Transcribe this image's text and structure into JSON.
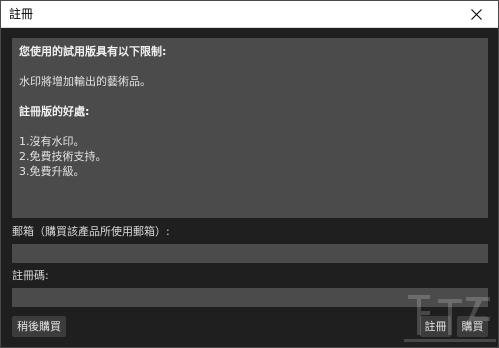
{
  "window": {
    "title": "註冊"
  },
  "icons": {
    "close": "close-icon"
  },
  "info": {
    "heading": "您使用的試用版具有以下限制:",
    "restriction": "水印將增加輸出的藝術品。",
    "benefits_heading": "註冊版的好處:",
    "benefits": [
      "1.沒有水印。",
      "2.免費技術支持。",
      "3.免費升級。"
    ]
  },
  "form": {
    "email_label": "郵箱（購買該產品所使用郵箱）:",
    "email_value": "",
    "code_label": "註冊碼:",
    "code_value": ""
  },
  "buttons": {
    "later": "稍後購買",
    "register": "註冊",
    "buy": "購買"
  },
  "colors": {
    "window_background": "#1f1f1f",
    "panel_background": "#4b4b4b",
    "titlebar_background": "#ffffff",
    "button_background": "#3c3c3c",
    "text": "#e2e2e2"
  }
}
